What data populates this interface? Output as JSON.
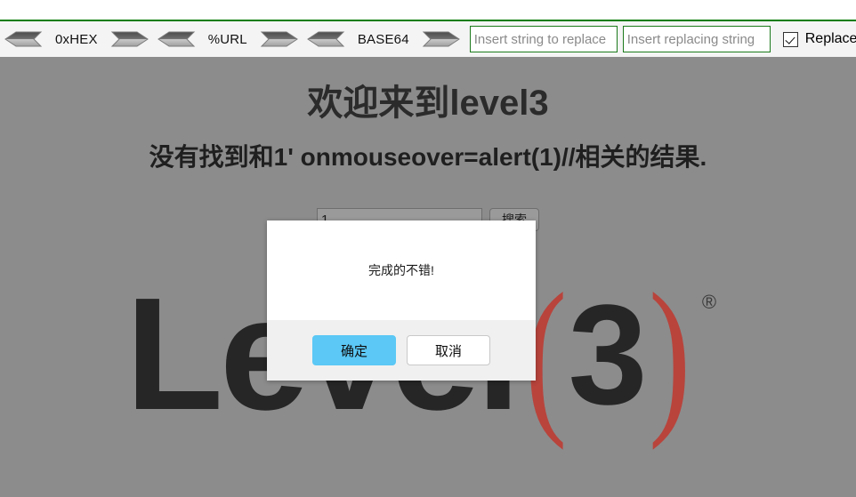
{
  "toolbar": {
    "codecs": [
      {
        "label": "0xHEX",
        "decode_icon": "left-arrow-icon",
        "encode_icon": "right-arrow-icon"
      },
      {
        "label": "%URL",
        "decode_icon": "left-arrow-icon",
        "encode_icon": "right-arrow-icon"
      },
      {
        "label": "BASE64",
        "decode_icon": "left-arrow-icon",
        "encode_icon": "right-arrow-icon"
      }
    ],
    "search_input": {
      "value": "",
      "placeholder": "Insert string to replace"
    },
    "replace_input": {
      "value": "",
      "placeholder": "Insert replacing string"
    },
    "replace_all": {
      "label": "Replace All",
      "checked": true,
      "icon": "checkbox-checked-icon"
    },
    "apply_icon": "right-arrow-icon",
    "accent_color": "#1c7a1c"
  },
  "page": {
    "heading": "欢迎来到level3",
    "subheading": "没有找到和1' onmouseover=alert(1)//相关的结果.",
    "search": {
      "value": "1",
      "placeholder": "",
      "submit_label": "搜索"
    },
    "logo": {
      "word": "Level",
      "open_paren": "(",
      "number": "3",
      "close_paren": ")",
      "registered": "®",
      "paren_color": "#b8443c",
      "word_color": "#262626"
    },
    "background_color": "#8c8c8c"
  },
  "dialog": {
    "message": "完成的不错!",
    "confirm_label": "确定",
    "cancel_label": "取消",
    "confirm_color": "#5bc8f5"
  }
}
